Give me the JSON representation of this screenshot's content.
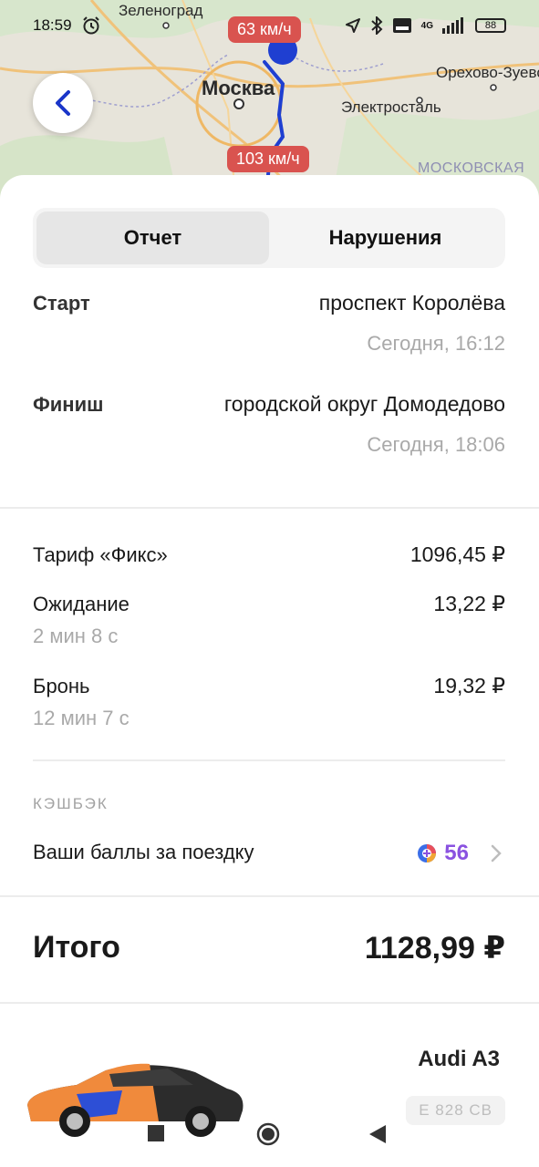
{
  "status_bar": {
    "time": "18:59",
    "battery": "88",
    "network": "4G"
  },
  "map": {
    "cities": [
      "Зеленоград",
      "Москва",
      "Орехово-Зуево",
      "Электросталь"
    ],
    "region": "МОСКОВСКАЯ",
    "speed_top": "63 км/ч",
    "speed_bottom": "103 км/ч",
    "route_color": "#1f3fd1"
  },
  "tabs": [
    "Отчет",
    "Нарушения"
  ],
  "route": {
    "start_label": "Старт",
    "start_address": "проспект Королёва",
    "start_time": "Сегодня, 16:12",
    "finish_label": "Финиш",
    "finish_address": "городской округ Домодедово",
    "finish_time": "Сегодня, 18:06"
  },
  "costs": {
    "tariff_label": "Тариф «Фикс»",
    "tariff_value": "1096,45 ₽",
    "waiting_label": "Ожидание",
    "waiting_duration": "2 мин 8 с",
    "waiting_value": "13,22 ₽",
    "booking_label": "Бронь",
    "booking_duration": "12 мин 7 с",
    "booking_value": "19,32 ₽"
  },
  "cashback": {
    "caption": "КЭШБЭК",
    "label": "Ваши баллы за поездку",
    "points": "56"
  },
  "total": {
    "label": "Итого",
    "value": "1128,99 ₽"
  },
  "car": {
    "model": "Audi A3",
    "plate": "Е 828 СВ"
  },
  "colors": {
    "accent": "#1a35c9",
    "speed_badge": "#d9534f",
    "points": "#8a52e0"
  }
}
